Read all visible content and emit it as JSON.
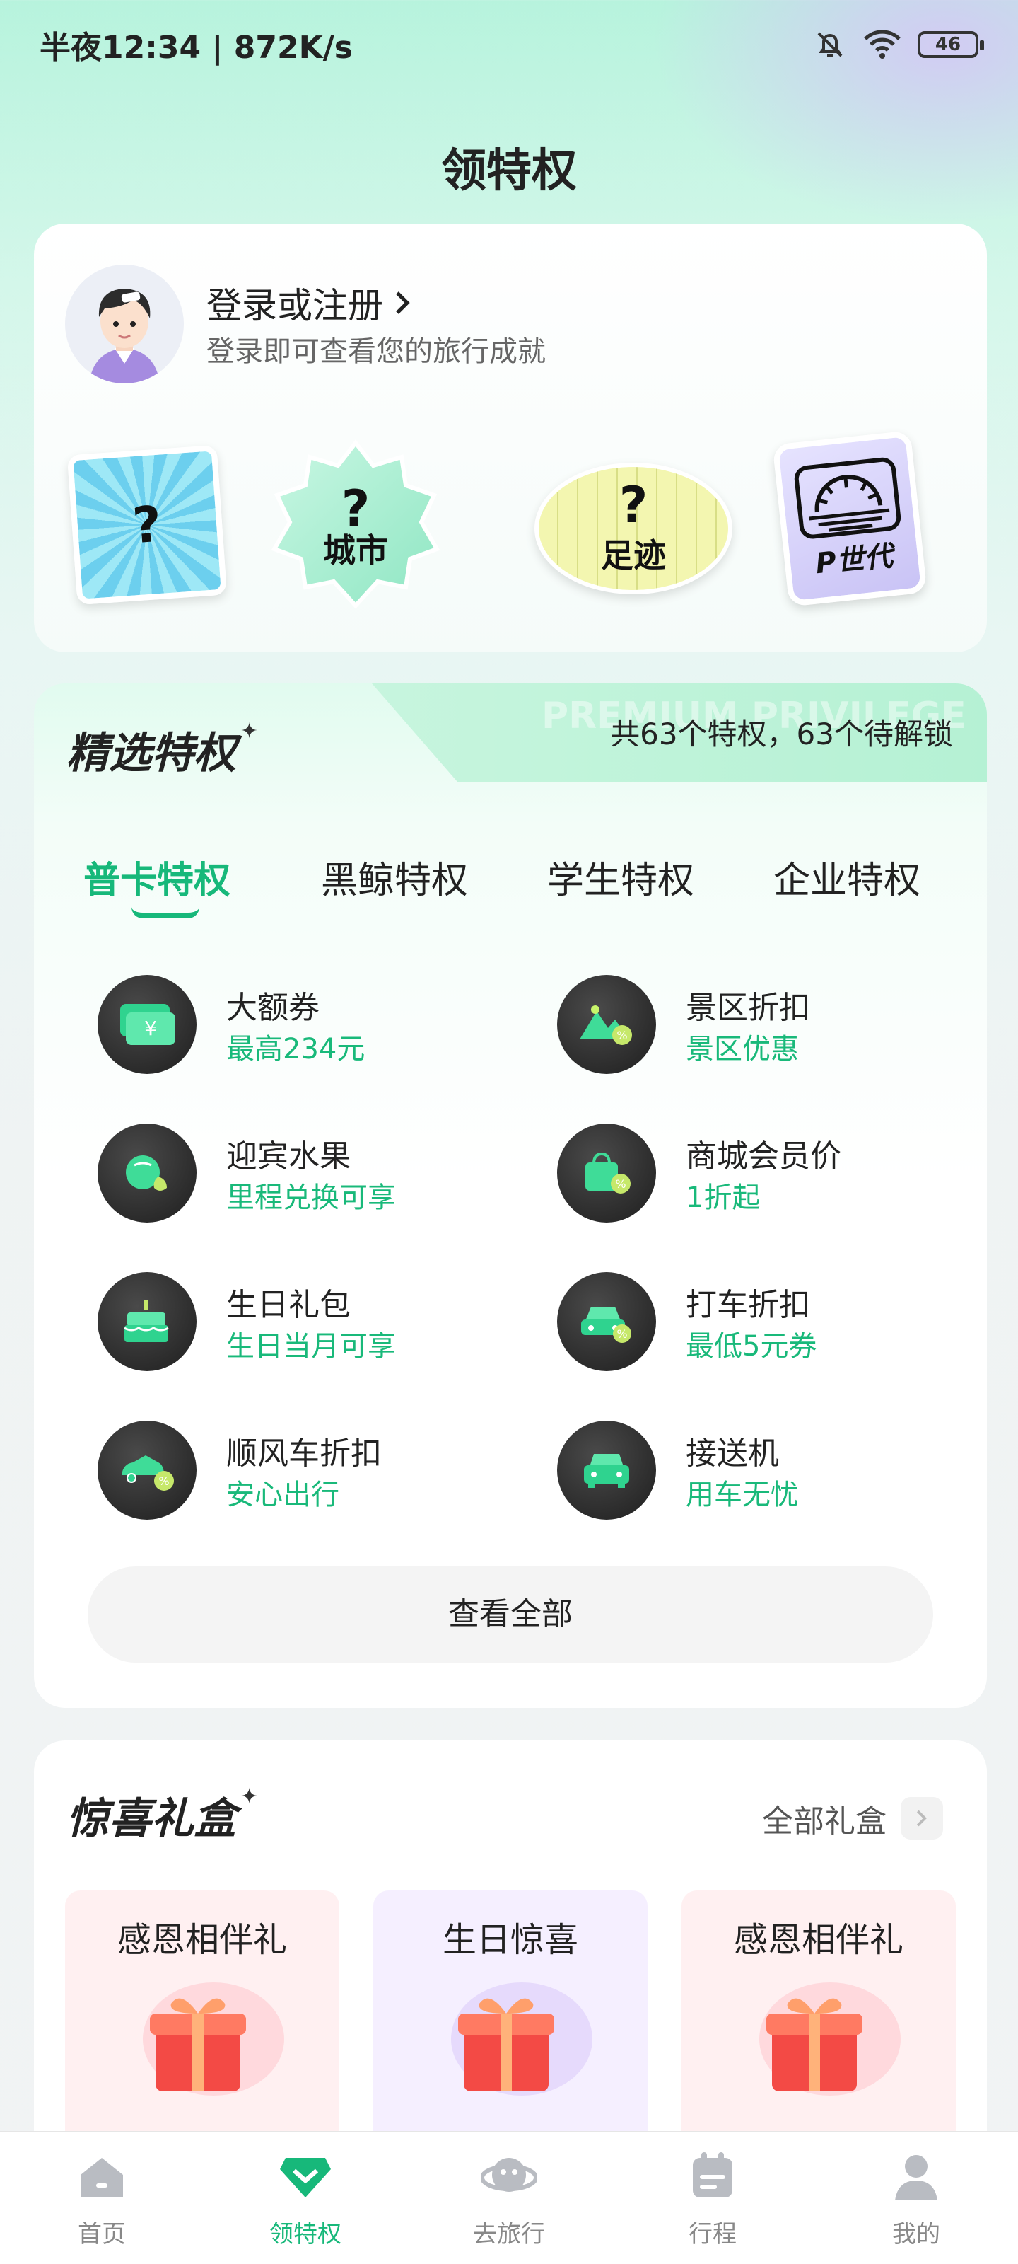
{
  "status_bar": {
    "time": "半夜12:34 | 872K/s",
    "battery": "46"
  },
  "page": {
    "title": "领特权"
  },
  "profile": {
    "login_label": "登录或注册",
    "subtitle": "登录即可查看您的旅行成就",
    "badges": [
      {
        "mark": "?",
        "label": ""
      },
      {
        "mark": "?",
        "label": "城市"
      },
      {
        "mark": "?",
        "label": "足迹"
      },
      {
        "mark": "",
        "label": "P世代"
      }
    ]
  },
  "privileges": {
    "title": "精选特权",
    "count_text": "共63个特权，63个待解锁",
    "watermark": "PREMIUM PRIVILEGE",
    "tabs": [
      "普卡特权",
      "黑鲸特权",
      "学生特权",
      "企业特权"
    ],
    "active_tab": 0,
    "items": [
      {
        "name": "大额券",
        "desc": "最高234元",
        "icon": "coupon-icon"
      },
      {
        "name": "景区折扣",
        "desc": "景区优惠",
        "icon": "scenic-discount-icon"
      },
      {
        "name": "迎宾水果",
        "desc": "里程兑换可享",
        "icon": "fruit-icon"
      },
      {
        "name": "商城会员价",
        "desc": "1折起",
        "icon": "shopping-bag-icon"
      },
      {
        "name": "生日礼包",
        "desc": "生日当月可享",
        "icon": "birthday-cake-icon"
      },
      {
        "name": "打车折扣",
        "desc": "最低5元券",
        "icon": "taxi-discount-icon"
      },
      {
        "name": "顺风车折扣",
        "desc": "安心出行",
        "icon": "carpool-discount-icon"
      },
      {
        "name": "接送机",
        "desc": "用车无忧",
        "icon": "airport-car-icon"
      }
    ],
    "view_all": "查看全部"
  },
  "gifts": {
    "title": "惊喜礼盒",
    "all_label": "全部礼盒",
    "boxes": [
      {
        "title": "感恩相伴礼",
        "bg": "#fff0f1"
      },
      {
        "title": "生日惊喜",
        "bg": "#f5efff"
      },
      {
        "title": "感恩相伴礼",
        "bg": "#fff0f1"
      }
    ]
  },
  "tabbar": {
    "items": [
      {
        "label": "首页",
        "icon": "home-icon"
      },
      {
        "label": "领特权",
        "icon": "privilege-icon"
      },
      {
        "label": "去旅行",
        "icon": "planet-icon"
      },
      {
        "label": "行程",
        "icon": "itinerary-icon"
      },
      {
        "label": "我的",
        "icon": "profile-icon"
      }
    ],
    "active": 1
  },
  "colors": {
    "accent": "#17b87a",
    "accent_text": "#19b97a"
  }
}
